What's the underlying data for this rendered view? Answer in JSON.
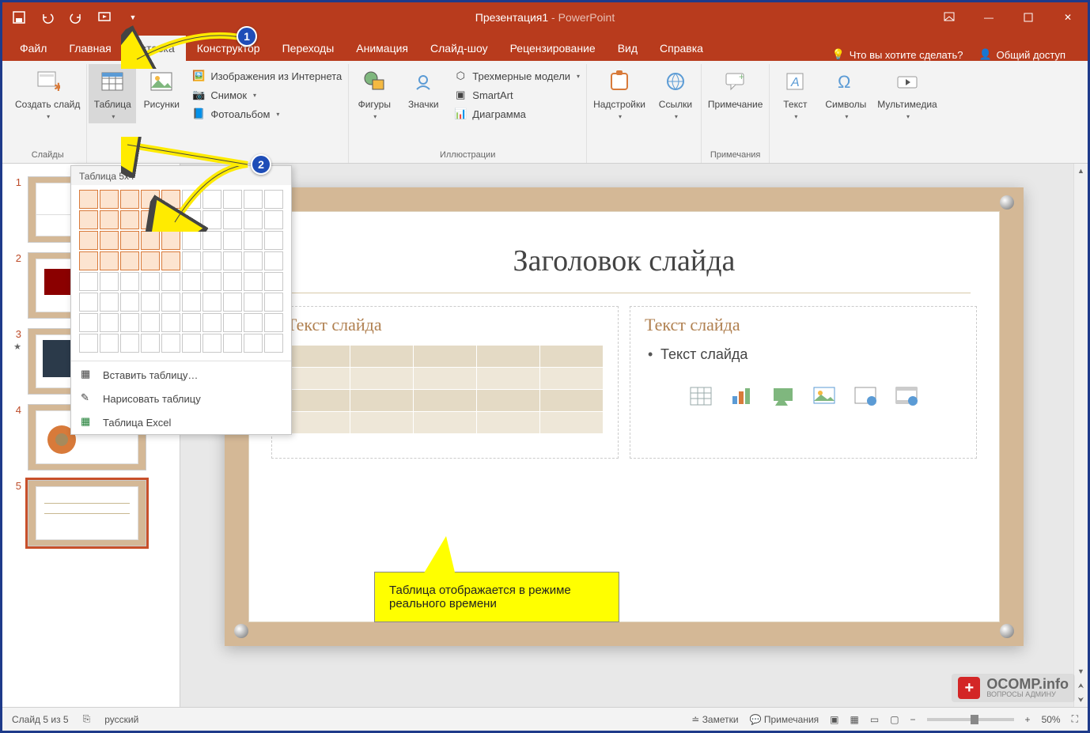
{
  "titlebar": {
    "doc": "Презентация1",
    "sep": " - ",
    "app": "PowerPoint"
  },
  "tabs": {
    "file": "Файл",
    "home": "Главная",
    "insert": "Вставка",
    "design": "Конструктор",
    "transitions": "Переходы",
    "animations": "Анимация",
    "slideshow": "Слайд-шоу",
    "review": "Рецензирование",
    "view": "Вид",
    "help": "Справка",
    "tellme": "Что вы хотите сделать?",
    "share": "Общий доступ"
  },
  "ribbon": {
    "groups": {
      "slides": "Слайды",
      "illustrations": "Иллюстрации",
      "comments": "Примечания"
    },
    "new_slide": "Создать слайд",
    "table": "Таблица",
    "pictures": "Рисунки",
    "online_pics": "Изображения из Интернета",
    "screenshot": "Снимок",
    "album": "Фотоальбом",
    "shapes": "Фигуры",
    "icons": "Значки",
    "models3d": "Трехмерные модели",
    "smartart": "SmartArt",
    "chart": "Диаграмма",
    "addins": "Надстройки",
    "links": "Ссылки",
    "comment": "Примечание",
    "text": "Текст",
    "symbols": "Символы",
    "media": "Мультимедиа"
  },
  "table_dd": {
    "title": "Таблица 5x4",
    "insert": "Вставить таблицу…",
    "draw": "Нарисовать таблицу",
    "excel": "Таблица Excel",
    "sel_cols": 5,
    "sel_rows": 4
  },
  "thumbs": [
    "1",
    "2",
    "3",
    "4",
    "5"
  ],
  "current_thumb": 5,
  "slide": {
    "title": "Заголовок слайда",
    "text_left": "Текст слайда",
    "text_right": "Текст слайда",
    "bullet": "Текст слайда"
  },
  "callout": "Таблица отображается в режиме реального времени",
  "status": {
    "slide_pos": "Слайд 5 из 5",
    "lang": "русский",
    "notes": "Заметки",
    "comments": "Примечания",
    "zoom": "50%"
  },
  "watermark": {
    "title": "OCOMP.info",
    "sub": "ВОПРОСЫ АДМИНУ"
  },
  "badges": {
    "one": "1",
    "two": "2"
  }
}
